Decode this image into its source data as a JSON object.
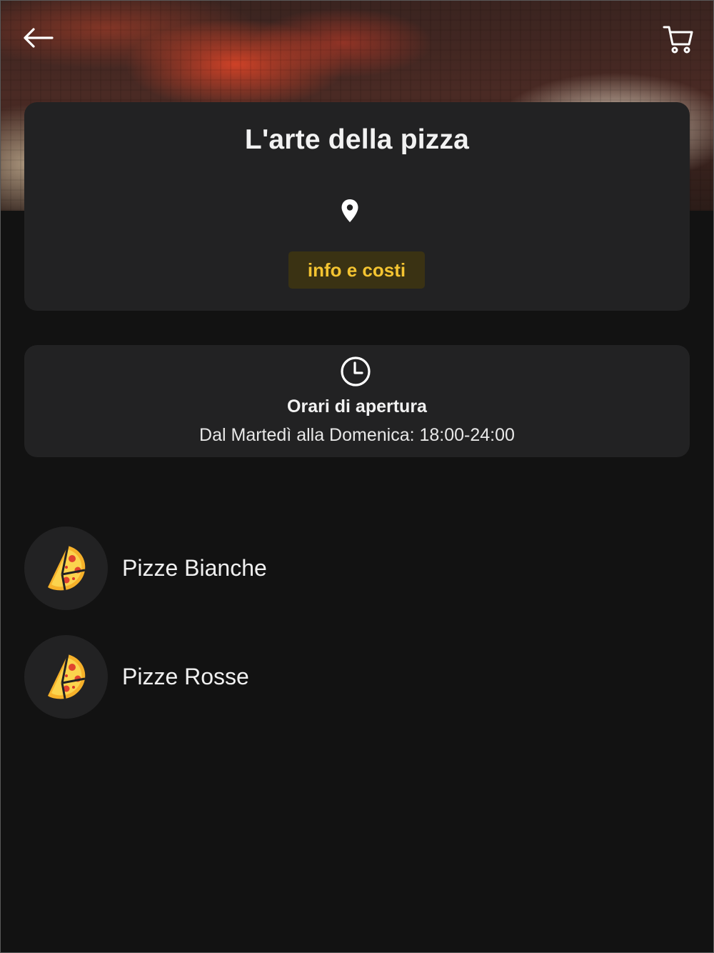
{
  "header": {
    "back_icon": "arrow-left-icon",
    "cart_icon": "shopping-cart-icon"
  },
  "restaurant": {
    "name": "L'arte della pizza",
    "location_icon": "map-pin-icon",
    "info_button_label": "info e costi",
    "accent_color": "#f4c431"
  },
  "hours": {
    "icon": "clock-icon",
    "title": "Orari di apertura",
    "text": "Dal Martedì alla Domenica: 18:00-24:00"
  },
  "categories": [
    {
      "label": "Pizze Bianche",
      "icon": "pizza-slice-icon"
    },
    {
      "label": "Pizze Rosse",
      "icon": "pizza-slice-icon"
    }
  ]
}
